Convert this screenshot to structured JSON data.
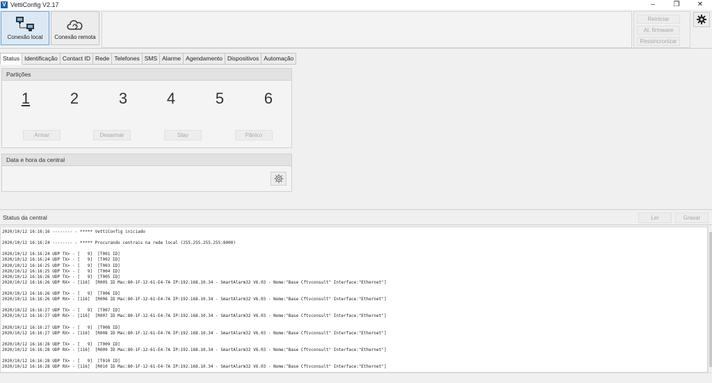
{
  "window": {
    "title": "VettiConfig V2.17",
    "logo_letter": "V",
    "controls": {
      "minimize": "–",
      "restore": "❐",
      "close": "✕"
    }
  },
  "toolbar": {
    "local_label": "Conexão local",
    "remote_label": "Conexão remota",
    "reiniciar": "Reiniciar",
    "firmware": "At. firmware",
    "ressincronizar": "Ressincronizar"
  },
  "tabs": [
    "Status",
    "Identificação",
    "Contact ID",
    "Rede",
    "Telefones",
    "SMS",
    "Alarme",
    "Agendamento",
    "Dispositivos",
    "Automação"
  ],
  "particoes": {
    "title": "Partições",
    "numbers": [
      "1",
      "2",
      "3",
      "4",
      "5",
      "6"
    ],
    "actions": [
      "Armar",
      "Desarmar",
      "Stay",
      "Pânico"
    ]
  },
  "datahora": {
    "title": "Data e hora da central"
  },
  "status": {
    "title": "Status da central",
    "ler": "Ler",
    "gravar": "Gravar"
  },
  "log": [
    "2020/10/12 16:16:16 -------- - ***** VettiConfig iniciado",
    "",
    "2020/10/12 16:16:24 -------- - ***** Procurando centrais na rede local (255.255.255.255:8000)",
    "",
    "2020/10/12 16:16:24 UDP TX> - [   9]  [T001 ID]",
    "2020/10/12 16:16:24 UDP TX> - [   9]  [T002 ID]",
    "2020/10/12 16:16:25 UDP TX> - [   9]  [T003 ID]",
    "2020/10/12 16:16:25 UDP TX> - [   9]  [T004 ID]",
    "2020/10/12 16:16:26 UDP TX> - [   9]  [T005 ID]",
    "2020/10/12 16:16:26 UDP RX> - [116]  [R005 ID Mac:80-1F-12-61-E4-7A IP:192.168.10.34 - SmartAlarm32 V6.03 - Nome:\"Base Cftvconsult\" Interface:\"Ethernet\"]",
    "",
    "2020/10/12 16:16:26 UDP TX> - [   9]  [T006 ID]",
    "2020/10/12 16:16:26 UDP RX> - [116]  [R006 ID Mac:80-1F-12-61-E4-7A IP:192.168.10.34 - SmartAlarm32 V6.03 - Nome:\"Base Cftvconsult\" Interface:\"Ethernet\"]",
    "",
    "2020/10/12 16:16:27 UDP TX> - [   9]  [T007 ID]",
    "2020/10/12 16:16:27 UDP RX> - [116]  [R007 ID Mac:80-1F-12-61-E4-7A IP:192.168.10.34 - SmartAlarm32 V6.03 - Nome:\"Base Cftvconsult\" Interface:\"Ethernet\"]",
    "",
    "2020/10/12 16:16:27 UDP TX> - [   9]  [T008 ID]",
    "2020/10/12 16:16:27 UDP RX> - [116]  [R008 ID Mac:80-1F-12-61-E4-7A IP:192.168.10.34 - SmartAlarm32 V6.03 - Nome:\"Base Cftvconsult\" Interface:\"Ethernet\"]",
    "",
    "2020/10/12 16:16:28 UDP TX> - [   9]  [T009 ID]",
    "2020/10/12 16:16:28 UDP RX> - [116]  [R009 ID Mac:80-1F-12-61-E4-7A IP:192.168.10.34 - SmartAlarm32 V6.03 - Nome:\"Base Cftvconsult\" Interface:\"Ethernet\"]",
    "",
    "2020/10/12 16:16:28 UDP TX> - [   9]  [T010 ID]",
    "2020/10/12 16:16:28 UDP RX> - [116]  [R010 ID Mac:80-1F-12-61-E4-7A IP:192.168.10.34 - SmartAlarm32 V6.03 - Nome:\"Base Cftvconsult\" Interface:\"Ethernet\"]"
  ],
  "icons": {
    "local": "network-computers-icon",
    "remote": "cloud-sync-icon",
    "settings": "gear-icon"
  },
  "colors": {
    "accent": "#6aa3d4",
    "logo": "#1c5fb0",
    "disabled_text": "#a7a7a7"
  }
}
